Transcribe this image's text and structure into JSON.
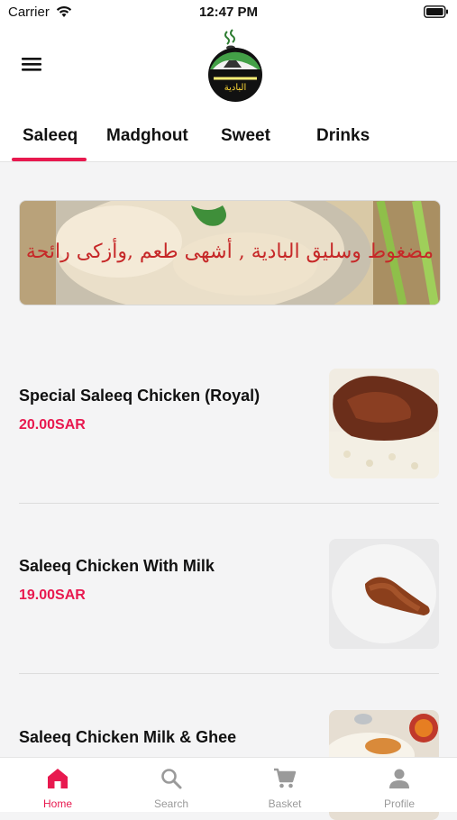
{
  "status_bar": {
    "carrier": "Carrier",
    "time": "12:47 PM"
  },
  "header": {
    "logo_icon": "bedouin-tent-logo"
  },
  "tabs": [
    {
      "label": "Saleeq",
      "active": true
    },
    {
      "label": "Madghout",
      "active": false
    },
    {
      "label": "Sweet",
      "active": false
    },
    {
      "label": "Drinks",
      "active": false
    }
  ],
  "banner": {
    "text": "مضغوط وسليق البادية , أشهى طعم ,وأزكى رائحة"
  },
  "products": [
    {
      "name": "Special Saleeq Chicken (Royal)",
      "price": "20.00SAR"
    },
    {
      "name": "Saleeq Chicken With Milk",
      "price": "19.00SAR"
    },
    {
      "name": "Saleeq Chicken Milk & Ghee",
      "price": ""
    }
  ],
  "bottom_nav": [
    {
      "label": "Home",
      "icon": "home-icon",
      "active": true
    },
    {
      "label": "Search",
      "icon": "search-icon",
      "active": false
    },
    {
      "label": "Basket",
      "icon": "cart-icon",
      "active": false
    },
    {
      "label": "Profile",
      "icon": "person-icon",
      "active": false
    }
  ],
  "colors": {
    "accent": "#e8194f",
    "banner_text": "#c62828",
    "background": "#f4f4f5"
  }
}
